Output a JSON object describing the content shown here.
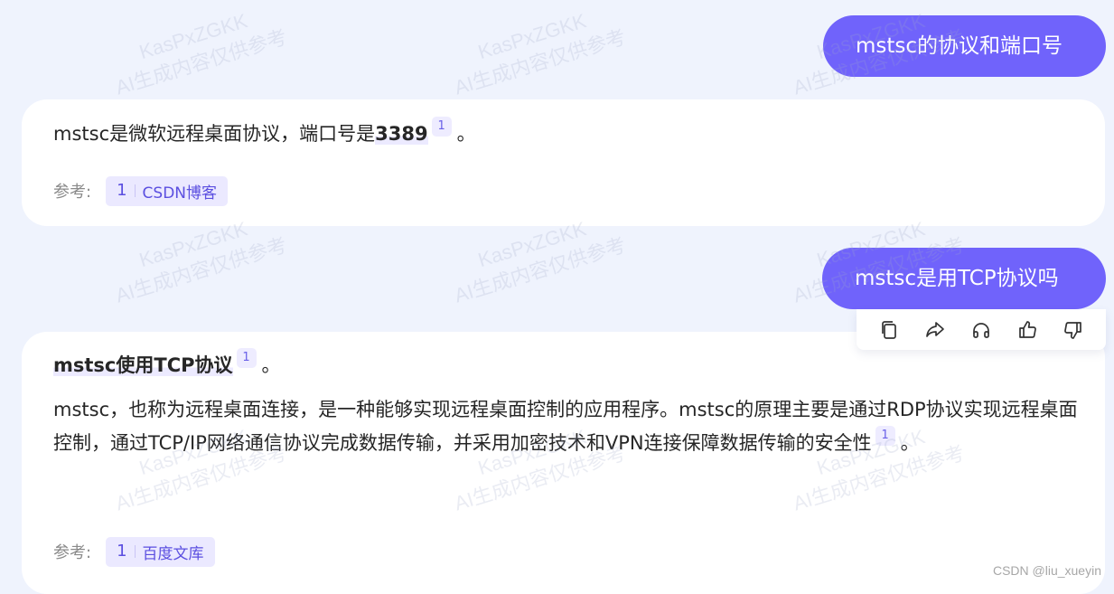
{
  "watermark": {
    "line1": "KasPxZGKK",
    "line2": "AI生成内容仅供参考"
  },
  "conversation": [
    {
      "question": "mstsc的协议和端口号",
      "answer": {
        "lead": "mstsc是微软远程桌面协议，端口号是",
        "highlight": "3389",
        "citation": "1",
        "trail": "。"
      },
      "reference": {
        "label": "参考:",
        "number": "1",
        "source": "CSDN博客"
      }
    },
    {
      "question": "mstsc是用TCP协议吗",
      "answer": {
        "highlight": "mstsc使用TCP协议",
        "citation": "1",
        "trail": "。",
        "paragraph": "mstsc，也称为远程桌面连接，是一种能够实现远程桌面控制的应用程序。mstsc的原理主要是通过RDP协议实现远程桌面控制，通过TCP/IP网络通信协议完成数据传输，并采用加密技术和VPN连接保障数据传输的安全性",
        "paragraph_citation": "1",
        "paragraph_trail": "。"
      },
      "reference": {
        "label": "参考:",
        "number": "1",
        "source": "百度文库"
      }
    }
  ],
  "actions": [
    {
      "name": "copy-icon"
    },
    {
      "name": "share-icon"
    },
    {
      "name": "headphones-icon"
    },
    {
      "name": "thumbs-up-icon"
    },
    {
      "name": "thumbs-down-icon"
    }
  ],
  "credit": "CSDN @liu_xueyin",
  "colors": {
    "background": "#eff3fd",
    "user_bubble": "#7063fb",
    "accent_text": "#5b4fe0",
    "chip_bg": "#ebe9ff"
  }
}
